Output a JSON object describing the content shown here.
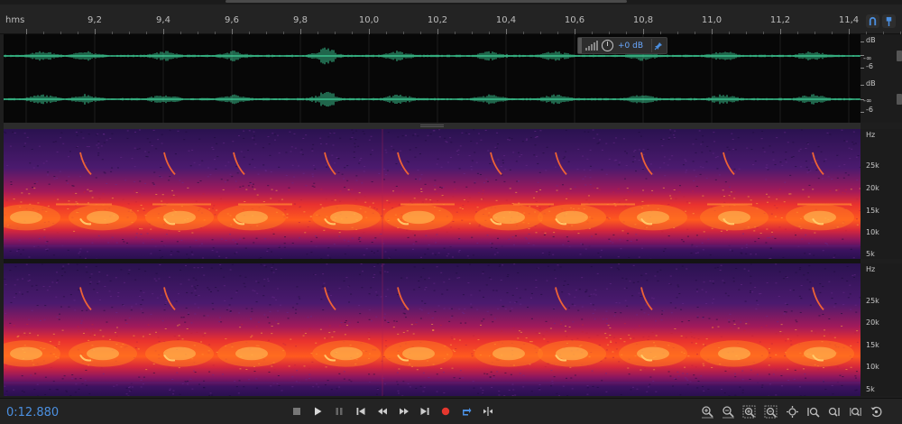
{
  "ruler": {
    "unit_label": "hms",
    "ticks": [
      "9,2",
      "9,4",
      "9,6",
      "9,8",
      "10,0",
      "10,2",
      "10,4",
      "10,6",
      "10,8",
      "11,0",
      "11,2",
      "11,4"
    ]
  },
  "waveform": {
    "channels": [
      {
        "db_label": "dB",
        "low_label": "-6"
      },
      {
        "db_label": "dB",
        "low_label": "-6"
      }
    ],
    "hud": {
      "gain_label": "+0 dB"
    }
  },
  "spectrogram": {
    "channels": [
      {
        "unit_label": "Hz",
        "freq_labels": [
          "25k",
          "20k",
          "15k",
          "10k",
          "5k"
        ]
      },
      {
        "unit_label": "Hz",
        "freq_labels": [
          "25k",
          "20k",
          "15k",
          "10k",
          "5k"
        ]
      }
    ]
  },
  "transport": {
    "time": "0:12.880",
    "accent_color": "#4b8fe0",
    "record_color": "#e5372e",
    "buttons": [
      "stop",
      "play",
      "pause",
      "skip-to-start",
      "rewind",
      "fast-forward",
      "skip-to-end",
      "record",
      "loop",
      "skip-selection"
    ],
    "zoom_buttons": [
      "zoom-in-amplitude",
      "zoom-out-amplitude",
      "zoom-in-time",
      "zoom-out-time",
      "zoom-to-selection",
      "zoom-in-left",
      "zoom-in-right",
      "zoom-out-full",
      "zoom-reset"
    ]
  },
  "colors": {
    "waveform": "#3fd29a",
    "spectrogram_low": "#3a1560",
    "spectrogram_high": "#ff5a1e"
  }
}
